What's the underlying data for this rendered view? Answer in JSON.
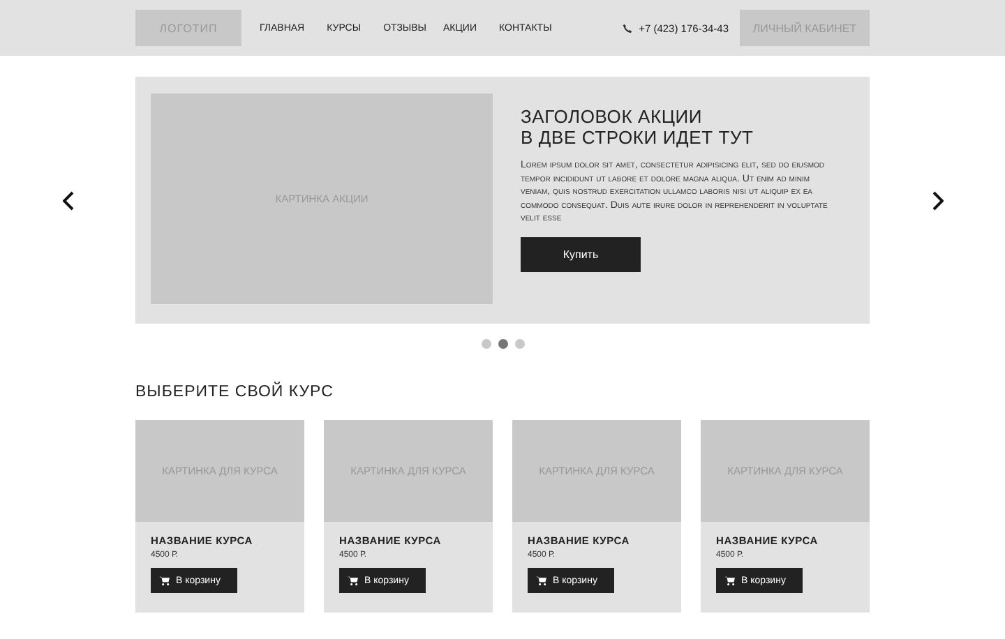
{
  "header": {
    "logo": "ЛОГОТИП",
    "nav": [
      {
        "label": "ГЛАВНАЯ"
      },
      {
        "label": "КУРСЫ"
      },
      {
        "label": "ОТЗЫВЫ"
      },
      {
        "label": "АКЦИИ"
      },
      {
        "label": "КОНТАКТЫ"
      }
    ],
    "phone": "+7 (423) 176-34-43",
    "account_button": "ЛИЧНЫЙ КАБИНЕТ"
  },
  "promo": {
    "image_label": "КАРТИНКА АКЦИИ",
    "title": "ЗАГОЛОВОК АКЦИИ\nВ ДВЕ СТРОКИ ИДЕТ ТУТ",
    "text": "Lorem ipsum dolor sit amet, consectetur adipisicing elit, sed do eiusmod tempor incididunt ut labore et dolore magna aliqua. Ut enim ad minim veniam, quis nostrud exercitation ullamco laboris nisi ut aliquip ex ea commodo consequat. Duis aute irure dolor in reprehenderit in voluptate velit esse",
    "button": "Купить",
    "dots": [
      {
        "selected": false
      },
      {
        "selected": true
      },
      {
        "selected": false
      }
    ]
  },
  "courses": {
    "heading": "ВЫБЕРИТЕ СВОЙ КУРС",
    "items": [
      {
        "image_label": "КАРТИНКА ДЛЯ КУРСА",
        "name": "НАЗВАНИЕ КУРСА",
        "price": "4500 Р.",
        "button": "В корзину"
      },
      {
        "image_label": "КАРТИНКА ДЛЯ КУРСА",
        "name": "НАЗВАНИЕ КУРСА",
        "price": "4500 Р.",
        "button": "В корзину"
      },
      {
        "image_label": "КАРТИНКА ДЛЯ КУРСА",
        "name": "НАЗВАНИЕ КУРСА",
        "price": "4500 Р.",
        "button": "В корзину"
      },
      {
        "image_label": "КАРТИНКА ДЛЯ КУРСА",
        "name": "НАЗВАНИЕ КУРСА",
        "price": "4500 Р.",
        "button": "В корзину"
      }
    ]
  }
}
